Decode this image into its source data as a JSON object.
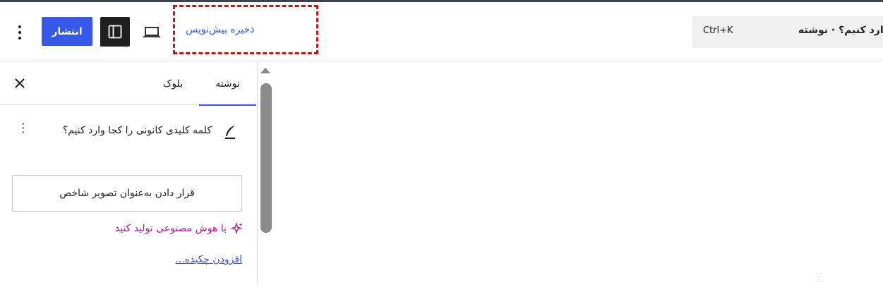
{
  "header": {
    "publish_label": "انتشار",
    "save_draft_label": "ذخیره پیش‌نویس",
    "command_shortcut": "Ctrl+K",
    "command_title": "وارد کنیم؟ · نوشته"
  },
  "sidebar": {
    "tabs": [
      {
        "label": "نوشته"
      },
      {
        "label": "بلوک"
      }
    ],
    "post_title": "کلمه کلیدی کانونی را کجا وارد کنیم؟",
    "featured_image_button": "قرار دادن به‌عنوان تصویر شاخص",
    "ai_generate_link": "با هوش مصنوعی تولید کنید",
    "add_excerpt_link": "افزودن چکیده..."
  },
  "colors": {
    "accent": "#3858e9",
    "ai_link": "#b0178f",
    "highlight_box": "#b71c1c"
  },
  "icons": {
    "menu": "vertical-ellipsis-icon",
    "sidebar_toggle": "sidebar-panel-icon",
    "device_preview": "laptop-icon",
    "close": "close-icon",
    "post": "quill-pen-icon",
    "ai": "sparkle-icon"
  }
}
